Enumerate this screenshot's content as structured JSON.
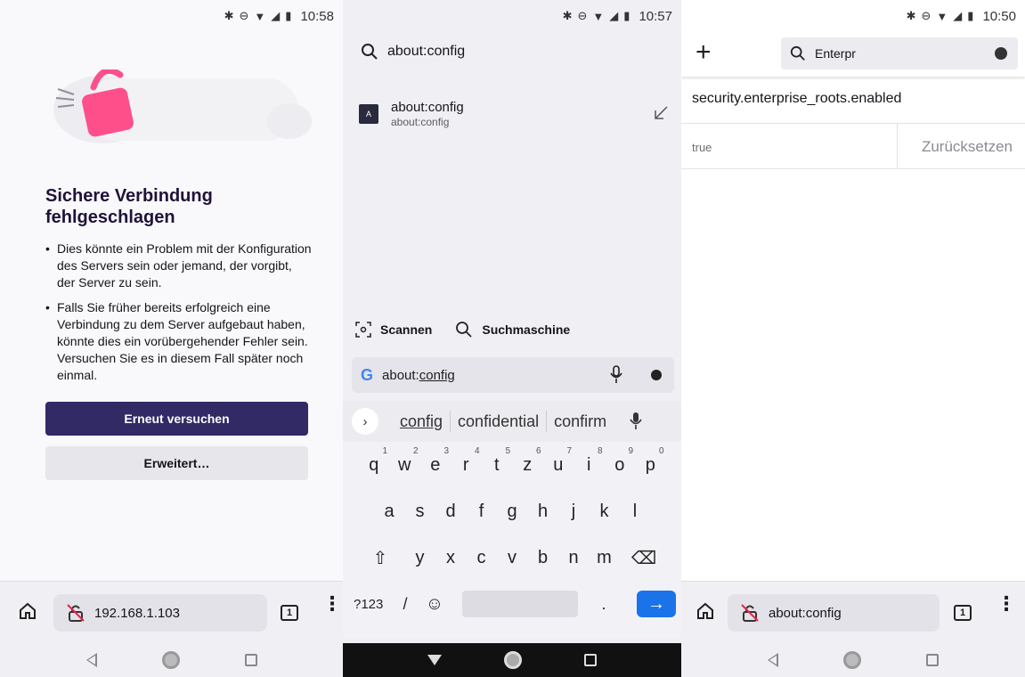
{
  "panel1": {
    "status_time": "10:58",
    "error_title": "Sichere Verbindung fehlgeschlagen",
    "bullets": [
      "Dies könnte ein Problem mit der Konfiguration des Servers sein oder jemand, der vorgibt, der Server zu sein.",
      "Falls Sie früher bereits erfolgreich eine Verbindung zu dem Server aufgebaut haben, könnte dies ein vorübergehender Fehler sein. Versuchen Sie es in diesem Fall später noch einmal."
    ],
    "retry_label": "Erneut versuchen",
    "advanced_label": "Erweitert…",
    "url": "192.168.1.103",
    "tab_count": "1"
  },
  "panel2": {
    "status_time": "10:57",
    "search_text": "about:config",
    "suggestion_title": "about:config",
    "suggestion_url": "about:config",
    "favicon_letter": "A",
    "scan_label": "Scannen",
    "engine_label": "Suchmaschine",
    "input_prefix": "about:",
    "input_underlined": "config",
    "kbd_suggestions": [
      "config",
      "confidential",
      "confirm"
    ],
    "row1": [
      "q",
      "w",
      "e",
      "r",
      "t",
      "z",
      "u",
      "i",
      "o",
      "p"
    ],
    "row1_nums": [
      "1",
      "2",
      "3",
      "4",
      "5",
      "6",
      "7",
      "8",
      "9",
      "0"
    ],
    "row2": [
      "a",
      "s",
      "d",
      "f",
      "g",
      "h",
      "j",
      "k",
      "l"
    ],
    "row3": [
      "y",
      "x",
      "c",
      "v",
      "b",
      "n",
      "m"
    ],
    "sym_key": "?123",
    "slash_key": "/",
    "period_key": "."
  },
  "panel3": {
    "status_time": "10:50",
    "search_value": "Enterpr",
    "pref_name": "security.enterprise_roots.enabled",
    "pref_value": "true",
    "reset_label": "Zurücksetzen",
    "url": "about:config",
    "tab_count": "1"
  },
  "colors": {
    "primary_button": "#312a65",
    "enter_key": "#1a73e8",
    "lock_pink": "#ff4f8a"
  }
}
